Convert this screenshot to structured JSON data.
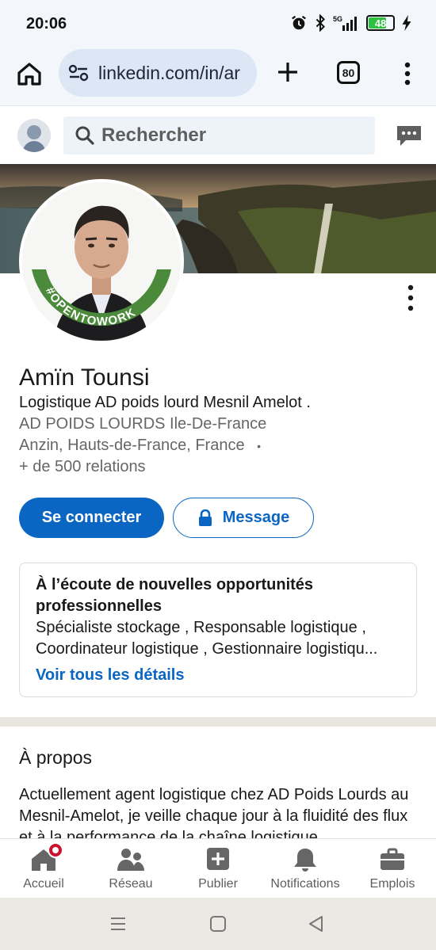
{
  "status": {
    "time": "20:06",
    "battery": "48",
    "network": "5G",
    "icons": [
      "alarm-icon",
      "bluetooth-icon",
      "signal-icon",
      "battery-icon",
      "charging-icon"
    ]
  },
  "browser": {
    "url": "linkedin.com/in/ar",
    "tab_count": "80"
  },
  "header": {
    "search_placeholder": "Rechercher"
  },
  "profile": {
    "name": "Amïn Tounsi",
    "headline": "Logistique AD poids lourd Mesnil Amelot .",
    "company": "AD POIDS LOURDS Ile-De-France",
    "location": "Anzin, Hauts-de-France, France",
    "location_sep": "•",
    "relations": "+ de 500 relations",
    "badge_text": "#OPENTOWORK"
  },
  "actions": {
    "connect": "Se connecter",
    "message": "Message"
  },
  "open_to_work": {
    "title": "À l’écoute de nouvelles opportunités professionnelles",
    "roles_line1": "Spécialiste stockage , Responsable logistique ,",
    "roles_line2": "Coordinateur logistique , Gestionnaire logistiqu...",
    "link": "Voir tous les détails"
  },
  "about": {
    "title": "À propos",
    "text": "Actuellement agent logistique chez AD Poids Lourds au Mesnil-Amelot, je veille chaque jour à la fluidité des flux et à la performance de la chaîne logistique"
  },
  "bottom_nav": [
    {
      "label": "Accueil",
      "icon": "home-icon"
    },
    {
      "label": "Réseau",
      "icon": "network-icon"
    },
    {
      "label": "Publier",
      "icon": "post-icon"
    },
    {
      "label": "Notifications",
      "icon": "bell-icon"
    },
    {
      "label": "Emplois",
      "icon": "briefcase-icon"
    }
  ],
  "colors": {
    "primary": "#0a66c2",
    "otw_green": "#4a8a3a",
    "badge_red": "#cb112d"
  }
}
